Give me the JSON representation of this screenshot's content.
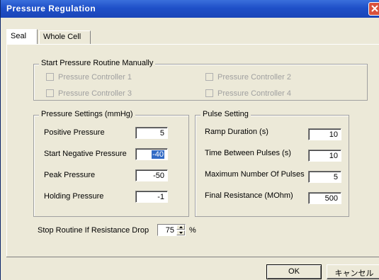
{
  "window": {
    "title": "Pressure Regulation"
  },
  "tabs": [
    {
      "label": "Seal",
      "active": true
    },
    {
      "label": "Whole Cell",
      "active": false
    }
  ],
  "manual_group": {
    "title": "Start Pressure Routine Manually",
    "controllers": [
      {
        "label": "Pressure Controller 1",
        "checked": false,
        "enabled": false
      },
      {
        "label": "Pressure Controller 2",
        "checked": false,
        "enabled": false
      },
      {
        "label": "Pressure Controller 3",
        "checked": false,
        "enabled": false
      },
      {
        "label": "Pressure Controller 4",
        "checked": false,
        "enabled": false
      }
    ]
  },
  "pressure_settings": {
    "title": "Pressure Settings (mmHg)",
    "fields": [
      {
        "label": "Positive Pressure",
        "value": "5"
      },
      {
        "label": "Start Negative Pressure",
        "value": "-40",
        "selected": true
      },
      {
        "label": "Peak Pressure",
        "value": "-50"
      },
      {
        "label": "Holding Pressure",
        "value": "-1"
      }
    ]
  },
  "pulse_setting": {
    "title": "Pulse Setting",
    "fields": [
      {
        "label": "Ramp Duration (s)",
        "value": "10"
      },
      {
        "label": "Time Between Pulses (s)",
        "value": "10"
      },
      {
        "label": "Maximum Number Of Pulses",
        "value": "5"
      },
      {
        "label": "Final Resistance (MOhm)",
        "value": "500"
      }
    ]
  },
  "stop_routine": {
    "label": "Stop Routine If Resistance Drop",
    "value": "75",
    "unit": "%"
  },
  "buttons": {
    "ok": "OK",
    "cancel": "キャンセル"
  },
  "colors": {
    "titlebar": "#1f50c8",
    "dialog_bg": "#ece9d8",
    "selection": "#316ac5",
    "close_button": "#d9513c"
  }
}
